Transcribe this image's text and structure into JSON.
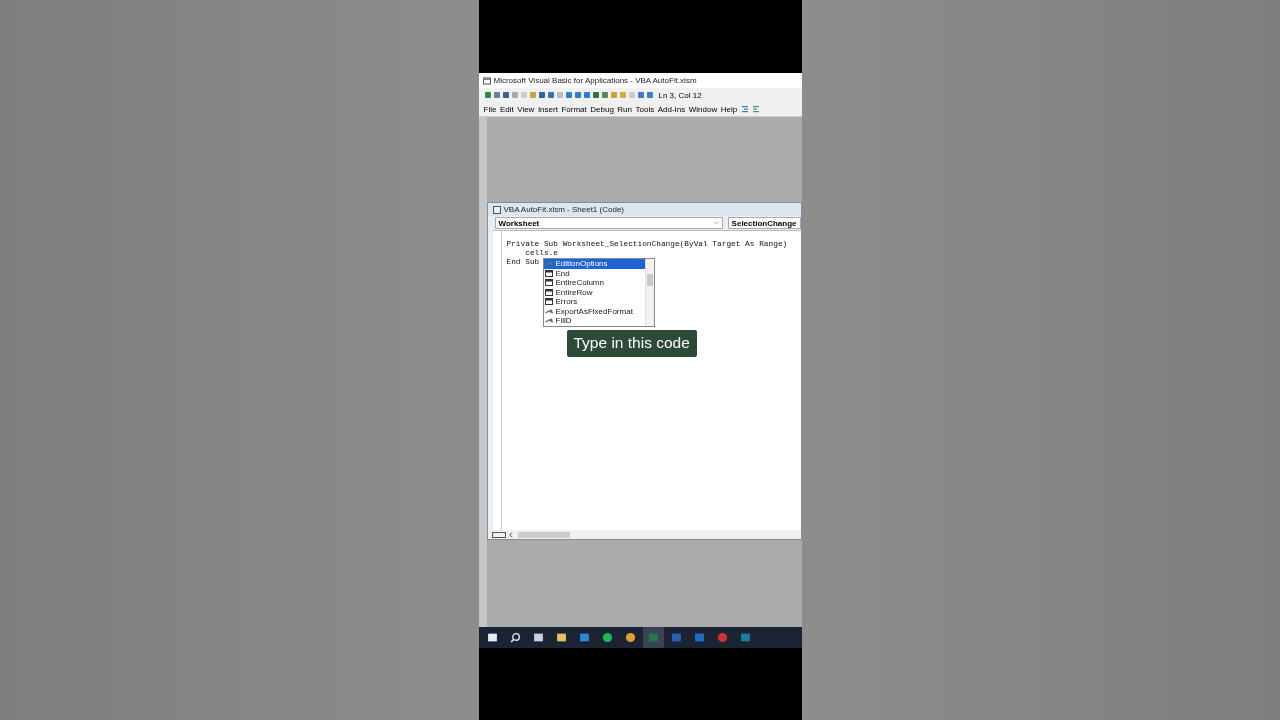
{
  "window": {
    "title": "Microsoft Visual Basic for Applications - VBA AutoFit.xlsm"
  },
  "toolbar": {
    "status": "Ln 3, Col 12"
  },
  "menu": [
    {
      "label": "File"
    },
    {
      "label": "Edit"
    },
    {
      "label": "View"
    },
    {
      "label": "Insert"
    },
    {
      "label": "Format"
    },
    {
      "label": "Debug"
    },
    {
      "label": "Run"
    },
    {
      "label": "Tools"
    },
    {
      "label": "Add-Ins"
    },
    {
      "label": "Window"
    },
    {
      "label": "Help"
    }
  ],
  "code_window": {
    "title": "VBA AutoFit.xlsm - Sheet1 (Code)",
    "object_dropdown": "Worksheet",
    "procedure_dropdown": "SelectionChange",
    "lines": [
      "Private Sub Worksheet_SelectionChange(ByVal Target As Range)",
      "    cells.e",
      "End Sub"
    ],
    "autocomplete": [
      {
        "label": "EditionOptions",
        "kind": "method",
        "selected": true
      },
      {
        "label": "End",
        "kind": "property",
        "selected": false
      },
      {
        "label": "EntireColumn",
        "kind": "property",
        "selected": false
      },
      {
        "label": "EntireRow",
        "kind": "property",
        "selected": false
      },
      {
        "label": "Errors",
        "kind": "property",
        "selected": false
      },
      {
        "label": "ExportAsFixedFormat",
        "kind": "method",
        "selected": false
      },
      {
        "label": "FillD",
        "kind": "method",
        "selected": false
      }
    ]
  },
  "caption": "Type in this code"
}
